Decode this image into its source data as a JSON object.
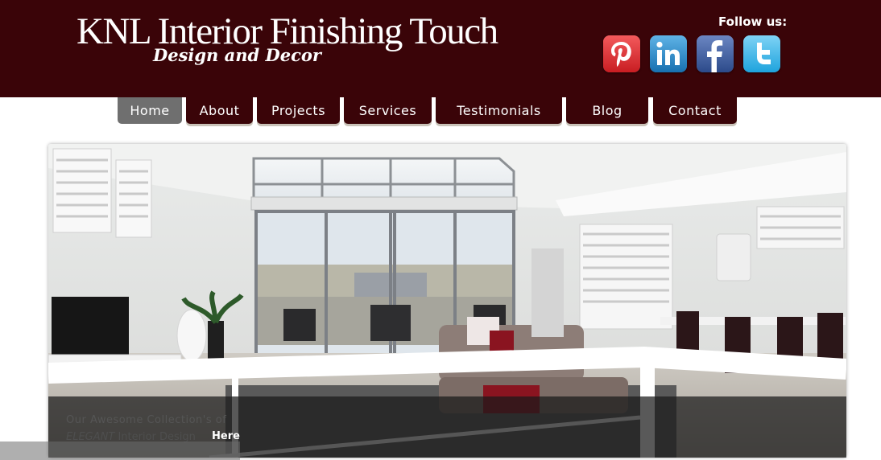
{
  "header": {
    "title": "KNL Interior Finishing Touch",
    "tagline": "Design and Decor",
    "follow_label": "Follow us:",
    "social": [
      {
        "icon": "pinterest-icon",
        "color": "#e3262b"
      },
      {
        "icon": "linkedin-icon",
        "color": "#1f88c9"
      },
      {
        "icon": "facebook-icon",
        "color": "#3b5a9b"
      },
      {
        "icon": "twitter-icon",
        "color": "#39b3e6"
      }
    ]
  },
  "nav": {
    "items": [
      "Home",
      "About",
      "Projects",
      "Services",
      "Testimonials",
      "Blog",
      "Contact"
    ],
    "active": "Home"
  },
  "hero": {
    "caption_line1": "Our Awesome Collection's of",
    "caption_em": "ELEGANT",
    "caption_rest": " Interior Design",
    "link_label": "Here"
  },
  "colors": {
    "brand": "#3a0408",
    "nav_active": "#6f6f6f"
  }
}
